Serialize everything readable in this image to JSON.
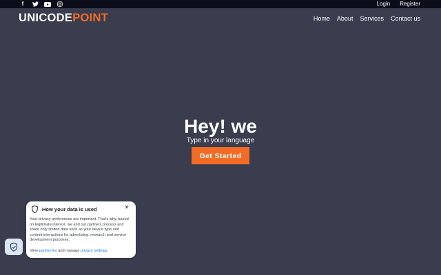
{
  "topbar": {
    "social_icons": [
      {
        "name": "facebook-icon",
        "glyph": "f"
      },
      {
        "name": "twitter-icon",
        "glyph": "t"
      },
      {
        "name": "youtube-icon",
        "glyph": "▶"
      },
      {
        "name": "instagram-icon",
        "glyph": "◎"
      }
    ],
    "login_label": "Login",
    "register_label": "Register"
  },
  "header": {
    "logo_part1": "UNICODE",
    "logo_part2": "POINT",
    "nav": [
      "Home",
      "About",
      "Services",
      "Contact us"
    ]
  },
  "hero": {
    "title": "Hey! we",
    "subtitle": "Type in your language",
    "cta_label": "Get Started"
  },
  "consent": {
    "title": "How your data is used",
    "close_glyph": "✕",
    "body": "Your privacy preferences are important. That's why, based on legitimate interest, we and our partners process and share only limited data such as your device type and content interactions for advertising, research and service development purposes.",
    "footer_prefix": "View ",
    "partner_link": "partner list",
    "footer_middle": " and manage ",
    "settings_link": "privacy settings",
    "footer_suffix": "."
  },
  "colors": {
    "background": "#393d4e",
    "topbar": "#0a0c19",
    "accent": "#f36b25",
    "link": "#1a73e8"
  }
}
